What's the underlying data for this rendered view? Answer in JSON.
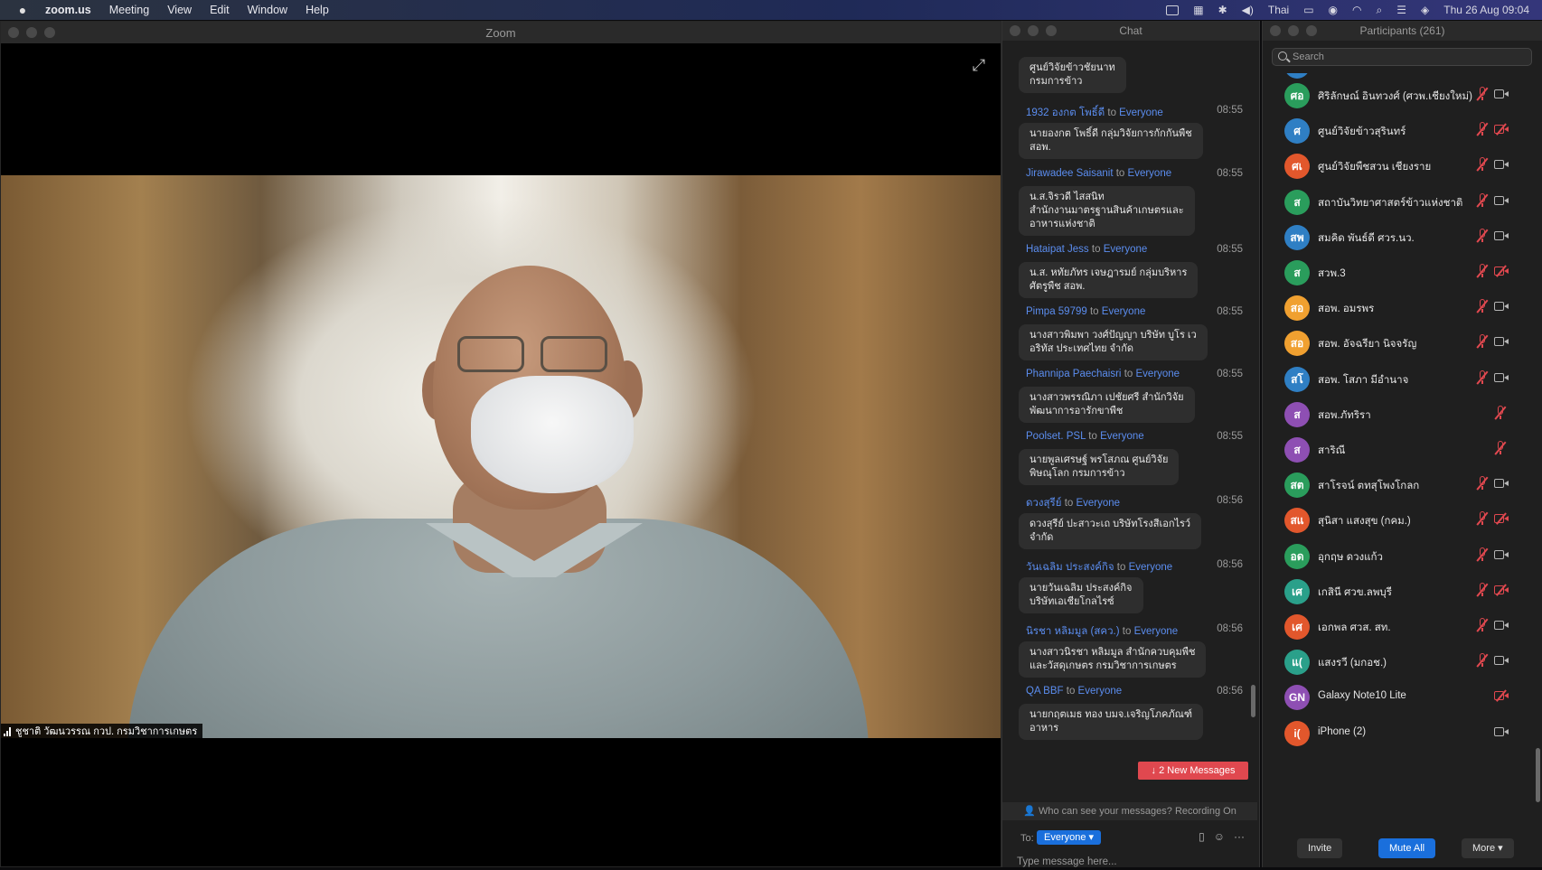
{
  "menubar": {
    "app": "zoom.us",
    "items": [
      "Meeting",
      "View",
      "Edit",
      "Window",
      "Help"
    ],
    "input_source": "Thai",
    "datetime": "Thu 26 Aug  09:04"
  },
  "zoom_window": {
    "title": "Zoom",
    "video_name": "ชูชาติ วัฒนวรรณ กวป. กรมวิชาการเกษตร"
  },
  "chat": {
    "title": "Chat",
    "to_word": "to",
    "top_bubble": "ศูนย์วิจัยข้าวชัยนาท\nกรมการข้าว",
    "messages": [
      {
        "sender": "1932 องกต โพธิ์ดี",
        "to": "Everyone",
        "time": "08:55",
        "text": "นายองกต โพธิ์ดี กลุ่มวิจัยการกักกันพืช\nสอพ."
      },
      {
        "sender": "Jirawadee Saisanit",
        "to": "Everyone",
        "time": "08:55",
        "text": "น.ส.จิรวดี ไสสนิท\nสำนักงานมาตรฐานสินค้าเกษตรและ\nอาหารแห่งชาติ"
      },
      {
        "sender": "Hataipat Jess",
        "to": "Everyone",
        "time": "08:55",
        "text": "น.ส. หทัยภัทร เจษฎารมย์ กลุ่มบริหาร\nศัตรูพืช สอพ."
      },
      {
        "sender": "Pimpa 59799",
        "to": "Everyone",
        "time": "08:55",
        "text": "นางสาวพิมพา วงศ์ปัญญา บริษัท บูโร เว\nอริทัส ประเทศไทย จำกัด"
      },
      {
        "sender": "Phannipa Paechaisri",
        "to": "Everyone",
        "time": "08:55",
        "text": "นางสาวพรรณิภา เปชัยศรี สำนักวิจัย\nพัฒนาการอารักขาพืช"
      },
      {
        "sender": "Poolset. PSL",
        "to": "Everyone",
        "time": "08:55",
        "text": "นายพูลเศรษฐ์ พรโสภณ ศูนย์วิจัย\nพิษณุโลก กรมการข้าว"
      },
      {
        "sender": "ดวงสุรีย์",
        "to": "Everyone",
        "time": "08:56",
        "text": "ดวงสุรีย์ ปะสาวะเถ  บริษัทโรงสีเอกไรว์\nจำกัด"
      },
      {
        "sender": "วันเฉลิม ประสงค์กิจ",
        "to": "Everyone",
        "time": "08:56",
        "text": "นายวันเฉลิม ประสงค์กิจ\nบริษัทเอเชียโกลไรซ์"
      },
      {
        "sender": "นิรชา หลิมมูล (สคว.)",
        "to": "Everyone",
        "time": "08:56",
        "text": "นางสาวนิรชา หลิมมูล สำนักควบคุมพืช\nและวัสดุเกษตร กรมวิชาการเกษตร"
      },
      {
        "sender": "QA BBF",
        "to": "Everyone",
        "time": "08:56",
        "text": "นายกฤตเมธ ทอง บมจ.เจริญโภคภัณฑ์\nอาหาร"
      }
    ],
    "new_messages": "2 New Messages",
    "who_can_see": "Who can see your messages? Recording On",
    "to_label": "To:",
    "recipient": "Everyone",
    "input_placeholder": "Type message here..."
  },
  "participants": {
    "title": "Participants (261)",
    "search_placeholder": "Search",
    "list": [
      {
        "initials": "ศอ",
        "name": "ศิริลักษณ์ อินทวงศ์ (ศวพ.เชียงใหม่)",
        "color": "#2a9d5c",
        "mic": "muted",
        "cam": "on"
      },
      {
        "initials": "ศ",
        "name": "ศูนย์วิจัยข้าวสุรินทร์",
        "color": "#2f7fc4",
        "mic": "muted",
        "cam": "off"
      },
      {
        "initials": "ศเ",
        "name": "ศูนย์วิจัยพืชสวน เชียงราย",
        "color": "#e2572c",
        "mic": "muted",
        "cam": "on"
      },
      {
        "initials": "ส",
        "name": "สถาบันวิทยาศาสตร์ข้าวแห่งชาติ",
        "color": "#2a9d5c",
        "mic": "muted",
        "cam": "on"
      },
      {
        "initials": "สพ",
        "name": "สมคิด พันธ์ดี ศวร.นว.",
        "color": "#2f7fc4",
        "mic": "muted",
        "cam": "on"
      },
      {
        "initials": "ส",
        "name": "สวพ.3",
        "color": "#2a9d5c",
        "mic": "muted",
        "cam": "off"
      },
      {
        "initials": "สอ",
        "name": "สอพ. อมรพร",
        "color": "#f0a030",
        "mic": "muted",
        "cam": "on"
      },
      {
        "initials": "สอ",
        "name": "สอพ. อัจฉรียา นิจจรัญ",
        "color": "#f0a030",
        "mic": "muted",
        "cam": "on"
      },
      {
        "initials": "สโ",
        "name": "สอพ. โสภา มีอำนาจ",
        "color": "#2f7fc4",
        "mic": "muted",
        "cam": "on"
      },
      {
        "initials": "ส",
        "name": "สอพ.ภัทริรา",
        "color": "#8e4fb3",
        "mic": "muted",
        "cam": "none"
      },
      {
        "initials": "ส",
        "name": "สาริณี",
        "color": "#8e4fb3",
        "mic": "muted",
        "cam": "none"
      },
      {
        "initials": "สต",
        "name": "สาโรจน์ ตทสุโพงโกลก",
        "color": "#2a9d5c",
        "mic": "muted",
        "cam": "on"
      },
      {
        "initials": "สแ",
        "name": "สุนิสา แสงสุข (กคม.)",
        "color": "#e2572c",
        "mic": "muted",
        "cam": "off"
      },
      {
        "initials": "อด",
        "name": "อุกฤษ ดวงแก้ว",
        "color": "#2a9d5c",
        "mic": "muted",
        "cam": "on"
      },
      {
        "initials": "เศ",
        "name": "เกสินี ศวข.ลพบุรี",
        "color": "#2aa08a",
        "mic": "muted",
        "cam": "off"
      },
      {
        "initials": "เศ",
        "name": "เอกพล ศวส. สท.",
        "color": "#e2572c",
        "mic": "muted",
        "cam": "on"
      },
      {
        "initials": "แ(",
        "name": "แสงรวี (มกอช.)",
        "color": "#2aa08a",
        "mic": "muted",
        "cam": "on"
      },
      {
        "initials": "GN",
        "name": "Galaxy Note10 Lite",
        "color": "#8e4fb3",
        "mic": "none",
        "cam": "off"
      },
      {
        "initials": "i(",
        "name": "iPhone (2)",
        "color": "#e2572c",
        "mic": "none",
        "cam": "on"
      }
    ],
    "invite": "Invite",
    "mute_all": "Mute All",
    "more": "More"
  }
}
